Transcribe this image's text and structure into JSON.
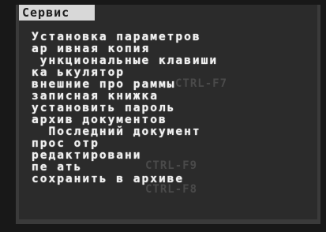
{
  "menu": {
    "title": "Сервис",
    "items": [
      "Установка параметров",
      "ар ивная копия",
      " ункциональные клавиши",
      "ка ькулятор",
      "внешние про раммы",
      "записная книжка",
      "установить пароль",
      "архив документов",
      "  Последний документ",
      "прос отр",
      "редактировани",
      "пе ать",
      "сохранить в архиве"
    ]
  },
  "ghost_shortcuts": [
    "CTRL-F7",
    "CTRL-F9",
    "CTRL-F8"
  ]
}
